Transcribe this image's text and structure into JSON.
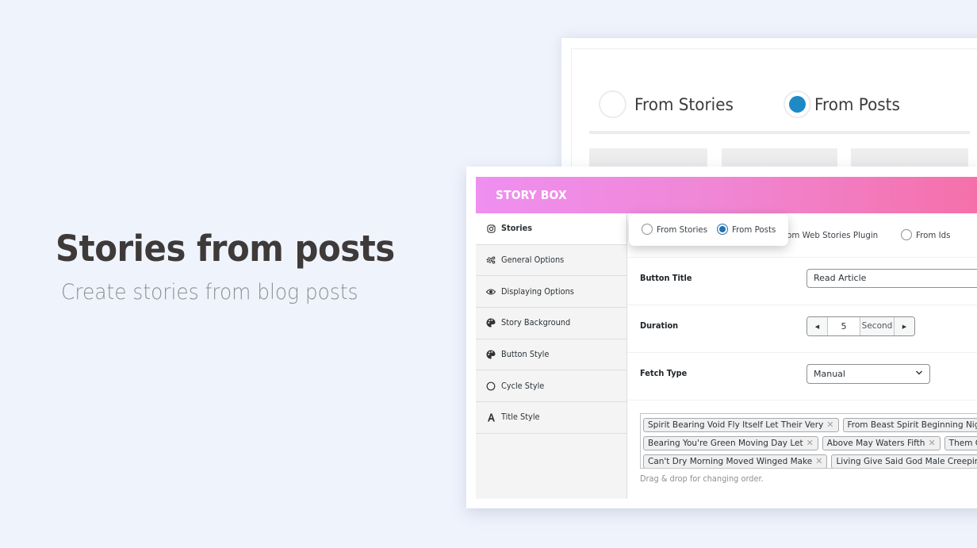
{
  "hero": {
    "title": "Stories from posts",
    "subtitle": "Create stories from blog posts"
  },
  "zoomed_source": {
    "options": [
      {
        "label": "From Stories",
        "selected": false
      },
      {
        "label": "From Posts",
        "selected": true
      }
    ],
    "accent_color": "#1d8ac5"
  },
  "app": {
    "brand": "STORY BOX",
    "header_gradient": [
      "#ef8ff0",
      "#f56fa8"
    ],
    "sidebar": {
      "items": [
        {
          "label": "Stories",
          "icon": "instagram-icon",
          "active": true
        },
        {
          "label": "General Options",
          "icon": "gears-icon",
          "active": false
        },
        {
          "label": "Displaying Options",
          "icon": "eye-icon",
          "active": false
        },
        {
          "label": "Story Background",
          "icon": "palette-icon",
          "active": false
        },
        {
          "label": "Button Style",
          "icon": "palette-icon",
          "active": false
        },
        {
          "label": "Cycle Style",
          "icon": "circle-icon",
          "active": false
        },
        {
          "label": "Title Style",
          "icon": "font-icon",
          "active": false
        }
      ]
    },
    "source": {
      "options": [
        {
          "label": "From Stories",
          "selected": false
        },
        {
          "label": "From Posts",
          "selected": true
        },
        {
          "label": "From Web Stories Plugin",
          "selected": false
        },
        {
          "label": "From Ids",
          "selected": false
        }
      ]
    },
    "fields": {
      "button_title": {
        "label": "Button Title",
        "value": "Read Article"
      },
      "duration": {
        "label": "Duration",
        "value": "5",
        "unit": "Second"
      },
      "fetch_type": {
        "label": "Fetch Type",
        "value": "Manual"
      }
    },
    "posts": {
      "rows": [
        [
          "Spirit Bearing Void Fly Itself Let Their Very",
          "From Beast Spirit Beginning Night To"
        ],
        [
          "Bearing You're Green Moving Day Let",
          "Above May Waters Fifth",
          "Them Created"
        ],
        [
          "Can't Dry Morning Moved Winged Make",
          "Living Give Said God Male Creeping Place"
        ]
      ],
      "remove_glyph": "✕",
      "hint": "Drag & drop for changing order."
    }
  }
}
